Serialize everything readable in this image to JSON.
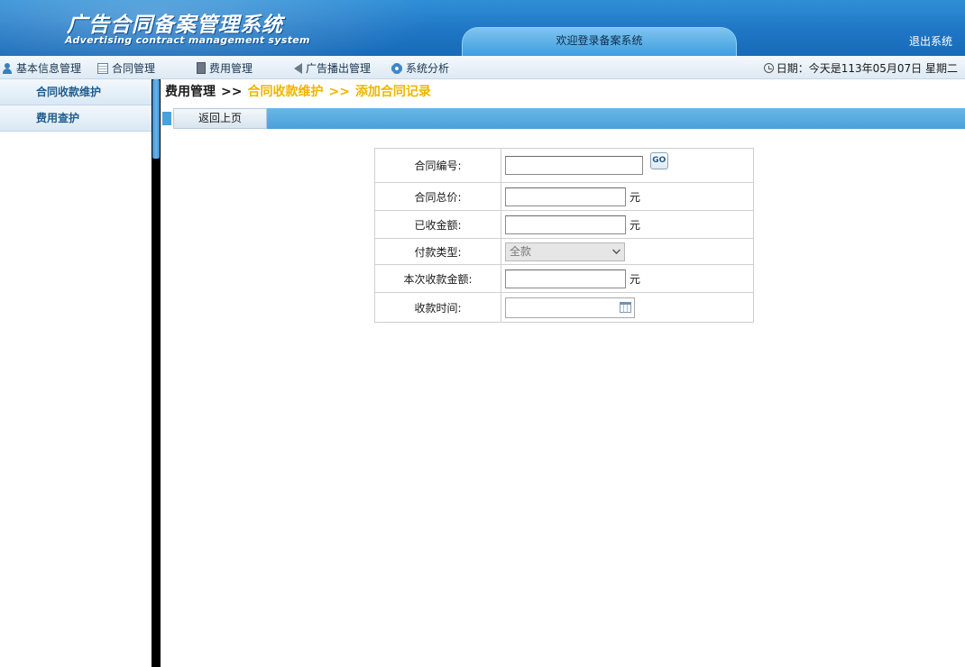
{
  "header": {
    "logo_cn": "广告合同备案管理系统",
    "logo_en": "Advertising contract management system",
    "welcome": "欢迎登录备案系统",
    "logout": "退出系统"
  },
  "nav": {
    "items": [
      {
        "label": "基本信息管理",
        "icon": "user-icon"
      },
      {
        "label": "合同管理",
        "icon": "table-icon"
      },
      {
        "label": "费用管理",
        "icon": "document-icon"
      },
      {
        "label": "广告播出管理",
        "icon": "speaker-icon"
      },
      {
        "label": "系统分析",
        "icon": "gear-icon"
      }
    ],
    "date": "日期：今天是113年05月07日  星期二"
  },
  "sidebar": {
    "items": [
      {
        "label": "合同收款维护"
      },
      {
        "label": "费用查护"
      }
    ]
  },
  "breadcrumb": {
    "root": "费用管理",
    "sep": ">>",
    "level1": "合同收款维护",
    "level2": "添加合同记录"
  },
  "toolbar": {
    "back_label": "返回上页"
  },
  "form": {
    "contract_no_label": "合同编号:",
    "contract_no_value": "",
    "go_label": "GO",
    "total_price_label": "合同总价:",
    "total_price_value": "",
    "received_label": "已收金额:",
    "received_value": "",
    "payment_type_label": "付款类型:",
    "payment_type_selected": "全款",
    "this_amount_label": "本次收款金额:",
    "this_amount_value": "",
    "time_label": "收款时间:",
    "time_value": "",
    "unit": "元"
  }
}
